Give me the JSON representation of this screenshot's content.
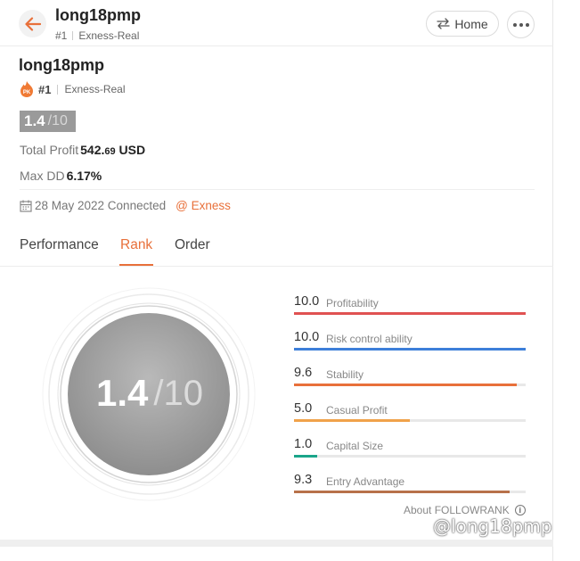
{
  "header": {
    "name": "long18pmp",
    "rank": "#1",
    "account": "Exness-Real",
    "home_label": "Home"
  },
  "profile": {
    "name": "long18pmp",
    "rank": "#1",
    "account": "Exness-Real",
    "pk_badge": "PK",
    "score": "1.4",
    "score_max": "/10",
    "total_profit_label": "Total Profit",
    "total_profit_int": "542.",
    "total_profit_dec": "69",
    "total_profit_unit": "USD",
    "max_dd_label": "Max DD",
    "max_dd_value": "6.17%",
    "connected_text": "28 May 2022 Connected",
    "broker": "@ Exness"
  },
  "tabs": [
    {
      "label": "Performance",
      "active": false
    },
    {
      "label": "Rank",
      "active": true
    },
    {
      "label": "Order",
      "active": false
    }
  ],
  "rank": {
    "score": "1.4",
    "score_max": "/10",
    "metrics": [
      {
        "value": "10.0",
        "label": "Profitability",
        "fraction": 1.0,
        "color": "#e05252"
      },
      {
        "value": "10.0",
        "label": "Risk control ability",
        "fraction": 1.0,
        "color": "#3d7fd9"
      },
      {
        "value": "9.6",
        "label": "Stability",
        "fraction": 0.96,
        "color": "#e8703a"
      },
      {
        "value": "5.0",
        "label": "Casual Profit",
        "fraction": 0.5,
        "color": "#f0a24a"
      },
      {
        "value": "1.0",
        "label": "Capital Size",
        "fraction": 0.1,
        "color": "#1aa58a"
      },
      {
        "value": "9.3",
        "label": "Entry Advantage",
        "fraction": 0.93,
        "color": "#b8714a"
      }
    ],
    "about_label": "About FOLLOWRANK"
  },
  "watermark": "@long18pmp",
  "colors": {
    "accent": "#e8703a",
    "badge_gray": "#9a9a9a"
  }
}
